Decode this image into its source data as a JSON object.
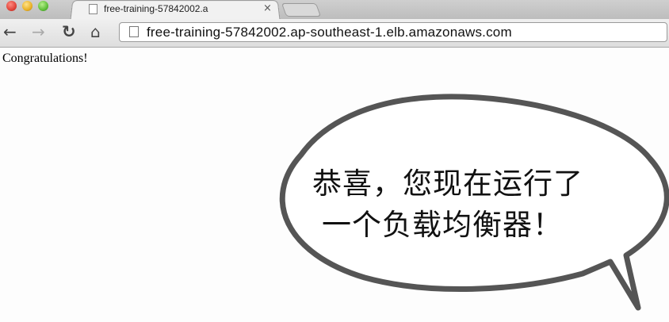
{
  "browser": {
    "tab": {
      "title": "free-training-57842002.a",
      "close_glyph": "×"
    },
    "nav": {
      "back_glyph": "←",
      "forward_glyph": "→",
      "reload_glyph": "↻",
      "home_glyph": "⌂"
    },
    "address_bar": {
      "url": "free-training-57842002.ap-southeast-1.elb.amazonaws.com"
    }
  },
  "page": {
    "body_text": "Congratulations!",
    "speech_bubble": {
      "line1": "恭喜，您现在运行了",
      "line2": "一个负载均衡器！"
    }
  }
}
